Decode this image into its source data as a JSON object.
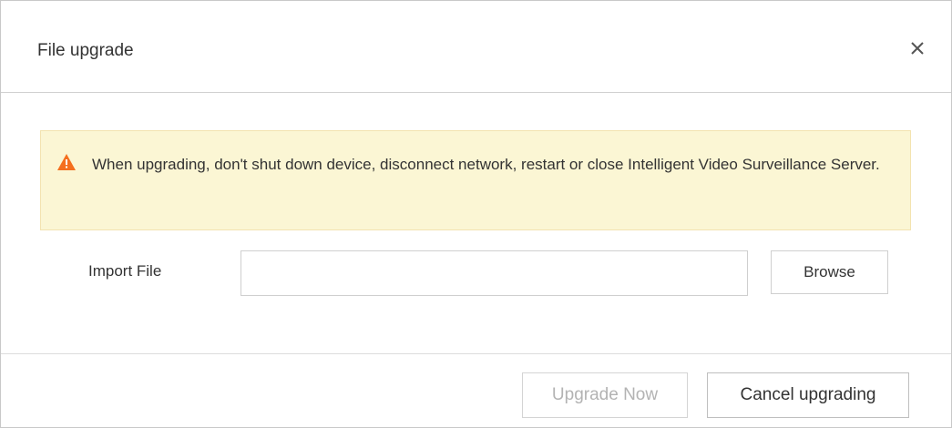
{
  "dialog": {
    "title": "File upgrade",
    "close_icon": "close-icon"
  },
  "warning": {
    "icon": "warning-triangle-icon",
    "icon_color": "#f46f1e",
    "text": "When upgrading, don't shut down device, disconnect network, restart or close Intelligent Video Surveillance Server.",
    "background": "#fbf6d4"
  },
  "import": {
    "label": "Import File",
    "value": "",
    "placeholder": "",
    "browse_label": "Browse"
  },
  "footer": {
    "upgrade_label": "Upgrade Now",
    "upgrade_disabled": true,
    "cancel_label": "Cancel upgrading"
  }
}
